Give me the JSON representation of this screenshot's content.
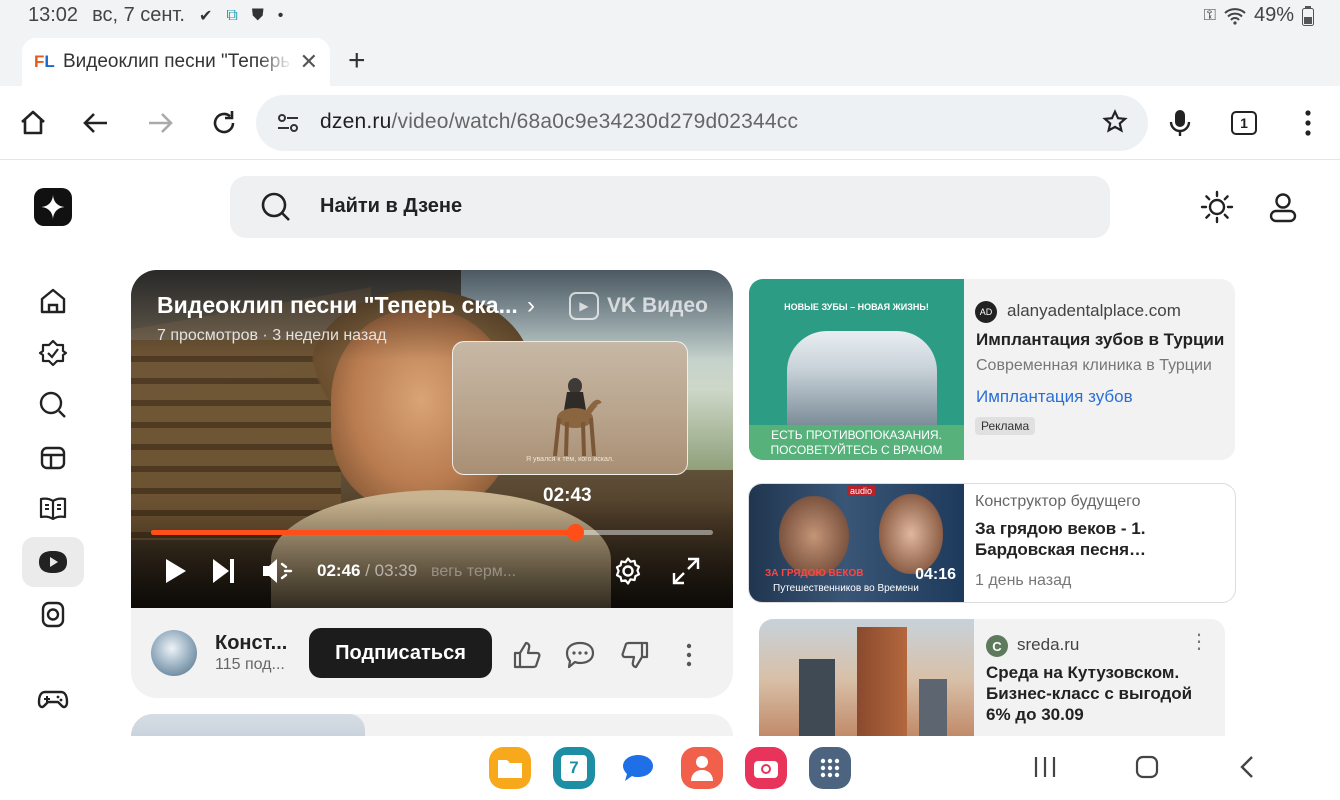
{
  "status_bar": {
    "time": "13:02",
    "date": "вс, 7 сент.",
    "battery": "49%"
  },
  "browser": {
    "tab_title": "Видеоклип песни \"Теперь с",
    "new_tab_label": "+",
    "url_host": "dzen.ru",
    "url_path": "/video/watch/68a0c9e34230d279d02344cc",
    "tab_count": "1"
  },
  "dzen": {
    "search_placeholder": "Найти в Дзене",
    "nav_items": [
      "home",
      "subscriptions",
      "search",
      "shorts",
      "articles",
      "video",
      "live",
      "games"
    ]
  },
  "player": {
    "title": "Видеоклип песни \"Теперь ска...",
    "meta": "7 просмотров · 3 недели назад",
    "brand": "VK Видео",
    "seek_preview_time": "02:43",
    "preview_subtitle": "Я увался к тем, кого искал.",
    "current_time": "02:46",
    "duration": "/ 03:39",
    "subtitle_ghost": "вегь терм...",
    "progress": 0.755,
    "accent": "#ff4e17"
  },
  "channel": {
    "name": "Конст...",
    "subs": "115 под...",
    "subscribe_label": "Подписаться"
  },
  "ad": {
    "img_headline": "НОВЫЕ ЗУБЫ – НОВАЯ ЖИЗНЬ!",
    "img_warning": "ЕСТЬ ПРОТИВОПОКАЗАНИЯ. ПОСОВЕТУЙТЕСЬ С ВРАЧОМ",
    "source_logo": "AD",
    "source": "alanyadentalplace.com",
    "title": "Имплантация зубов в Турции",
    "description": "Современная клиника в Турции",
    "link": "Имплантация зубов",
    "badge": "Реклама"
  },
  "video_card": {
    "audio_tag": "audio",
    "caption_red": "ЗА ГРЯДОЮ ВЕКОВ",
    "caption_white": "Путешественников во Времени",
    "duration": "04:16",
    "channel": "Конструктор будущего",
    "title": "За грядою веков - 1. Бардовская песня…",
    "date": "1 день назад"
  },
  "sreda_card": {
    "icon_letter": "С",
    "source": "sreda.ru",
    "title": "Среда на Кутузовском. Бизнес-класс с выгодой 6% до 30.09"
  },
  "dock_apps": [
    "files",
    "calendar",
    "messages",
    "contacts",
    "camera",
    "apps"
  ],
  "calendar_day": "7"
}
